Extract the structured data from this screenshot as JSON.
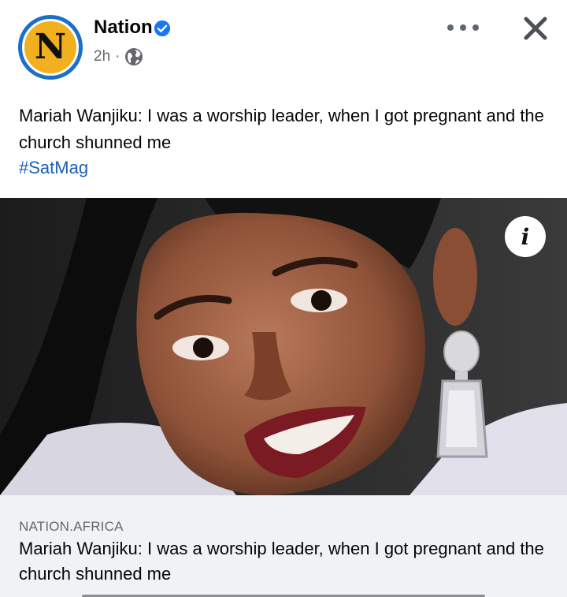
{
  "post": {
    "page_name": "Nation",
    "avatar_letter": "N",
    "time": "2h",
    "separator": "·",
    "audience_icon": "globe-icon",
    "verified_icon": "verified-badge-icon",
    "caption": "Mariah Wanjiku: I was a worship leader, when I got pregnant and the church shunned me",
    "hashtag": "#SatMag"
  },
  "actions": {
    "more_icon": "more-options-icon",
    "close_icon": "close-icon",
    "info_label": "i"
  },
  "link_preview": {
    "domain": "NATION.AFRICA",
    "title": "Mariah Wanjiku: I was a worship leader, when I got pregnant and the church shunned me"
  },
  "colors": {
    "brand_blue": "#1a6fc9",
    "brand_yellow": "#f2b01f",
    "hashtag": "#1b5fbf",
    "verified": "#1877f2",
    "card_bg": "#f0f2f5"
  }
}
